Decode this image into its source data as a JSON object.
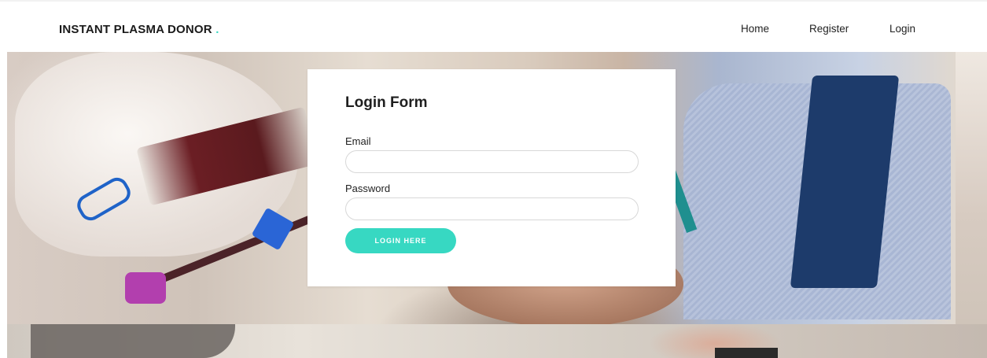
{
  "navbar": {
    "brand": "INSTANT PLASMA DONOR",
    "brand_dot": ".",
    "links": [
      {
        "label": "Home"
      },
      {
        "label": "Register"
      },
      {
        "label": "Login"
      }
    ]
  },
  "login_form": {
    "title": "Login Form",
    "email_label": "Email",
    "email_value": "",
    "password_label": "Password",
    "password_value": "",
    "submit_label": "LOGIN HERE"
  },
  "colors": {
    "accent": "#37d8c2",
    "text": "#1f1f1f"
  }
}
